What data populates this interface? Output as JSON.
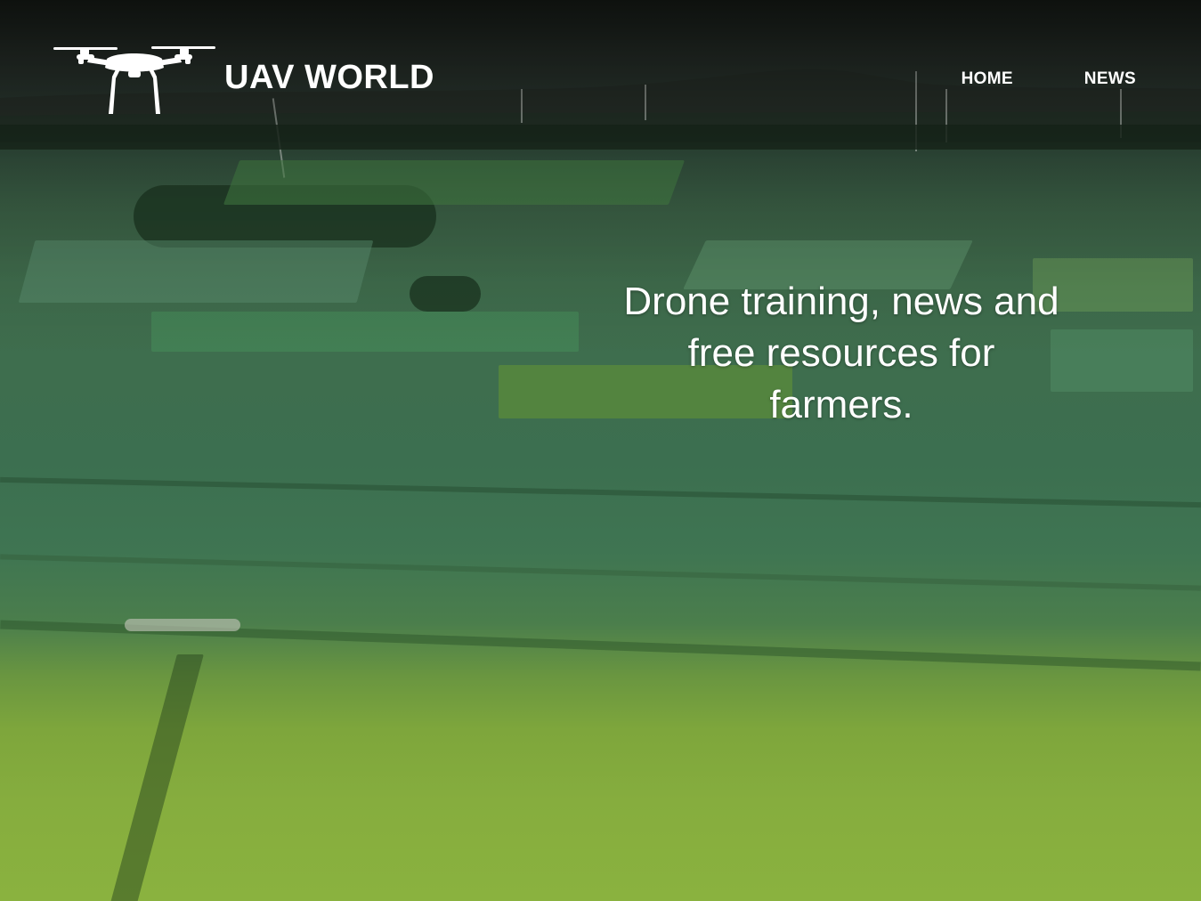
{
  "brand": {
    "name": "UAV WORLD",
    "logo_icon": "drone-icon"
  },
  "nav": {
    "items": [
      {
        "label": "HOME"
      },
      {
        "label": "NEWS"
      }
    ]
  },
  "hero": {
    "tagline": "Drone training, news and free resources for farmers.",
    "background": "aerial-farmland-photo"
  },
  "colors": {
    "text": "#ffffff",
    "sky_dark": "#1f2620",
    "field_green": "#3f7552",
    "field_yellow_green": "#86ad3e"
  }
}
